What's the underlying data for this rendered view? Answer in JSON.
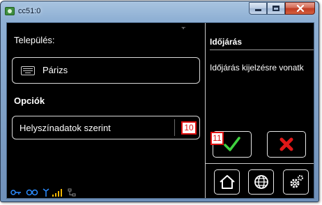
{
  "window": {
    "title": "cc51:0",
    "minimize_icon": "minimize-icon",
    "maximize_icon": "maximize-icon",
    "close_icon": "close-icon"
  },
  "left": {
    "settlement_label": "Település:",
    "city_value": "Párizs",
    "city_icon": "keyboard-icon",
    "options_label": "Opciók",
    "location_option": "Helyszínadatok szerint",
    "badge_10": "10"
  },
  "right": {
    "weather_title": "Időjárás",
    "weather_desc": "Időjárás kijelzésre vonatk",
    "badge_11": "11",
    "ok_icon": "check-icon",
    "cancel_icon": "x-icon",
    "nav": [
      "home-icon",
      "globe-icon",
      "gear-icon"
    ]
  },
  "status_bar": {
    "icons": [
      "key-icon",
      "link-icon",
      "antenna-icon",
      "signal-bars-icon",
      "network-icon"
    ]
  },
  "colors": {
    "background": "#000000",
    "check": "#3fd23f",
    "cancel": "#e01818",
    "status_icons": "#2a8bff",
    "signal_bars": "#f0b400",
    "badge": "#e01010"
  }
}
